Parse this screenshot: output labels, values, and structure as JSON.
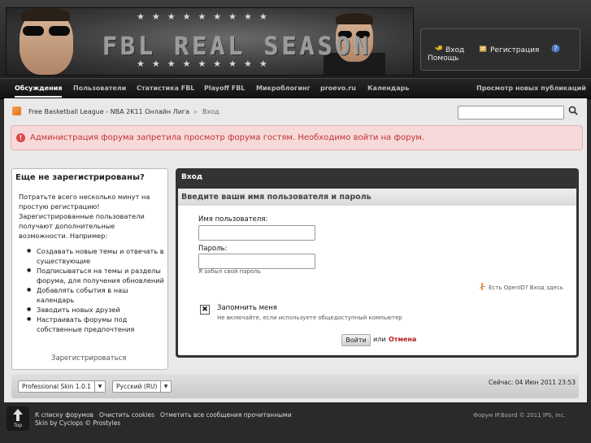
{
  "header": {
    "logo_text": "FBL REAL SEASON",
    "stars": "★★★★★★★★★",
    "login_label": "Вход",
    "register_label": "Регистрация",
    "help_label": "Помощь"
  },
  "nav": {
    "items": [
      {
        "label": "Обсуждения"
      },
      {
        "label": "Пользователи"
      },
      {
        "label": "Статистика FBL"
      },
      {
        "label": "Playoff FBL"
      },
      {
        "label": "Микроблогинг"
      },
      {
        "label": "proevo.ru"
      },
      {
        "label": "Календарь"
      }
    ],
    "new_posts": "Просмотр новых публикаций"
  },
  "breadcrumb": {
    "root": "Free Basketball League - NBA 2K11 Онлайн Лига",
    "separator": "»",
    "current": "Вход"
  },
  "error_message": "Администрация форума запретила просмотр форума гостям. Необходимо войти на форум.",
  "guest_panel": {
    "title": "Еще не зарегистрированы?",
    "intro": "Потратьте всего несколько минут на простую регистрацию! Зарегистрированные пользователи получают дополнительные возможности. Например:",
    "benefits": [
      "Создавать новые темы и отвечать в существующие",
      "Подписываться на темы и разделы форума, для получения обновлений",
      "Добавлять события в наш календарь",
      "Заводить новых друзей",
      "Настраивать форумы под собственные предпочтения"
    ],
    "register_link": "Зарегистрироваться"
  },
  "login": {
    "title": "Вход",
    "subtitle": "Введите ваши имя пользователя и пароль",
    "username_label": "Имя пользователя:",
    "username_value": "",
    "password_label": "Пароль:",
    "password_value": "",
    "forgot": "Я забыл свой пароль",
    "openid": "Есть OpenID? Вход здесь",
    "remember_label": "Запомнить меня",
    "remember_hint": "Не включайте, если используете общедоступный компьютер",
    "remember_checked": true,
    "login_button": "Войти",
    "or_text": "или",
    "cancel": "Отмена"
  },
  "bottom": {
    "skin": "Professional Skin 1.0.1",
    "language": "Русский (RU)",
    "time": "Сейчас: 04 Июн 2011 23:53"
  },
  "footer": {
    "top_label": "Top",
    "links": [
      "К списку форумов",
      "Очистить cookies",
      "Отметить все сообщения прочитанными"
    ],
    "skin_credit": "Skin by Cyclops © Prostyles",
    "copyright": "Форум IP.Board © 2011  IPS, Inc."
  },
  "colors": {
    "error_text": "#c43232",
    "error_bg": "#f6d9d9",
    "cancel": "#b41f1f",
    "panel_dark": "#333333"
  }
}
